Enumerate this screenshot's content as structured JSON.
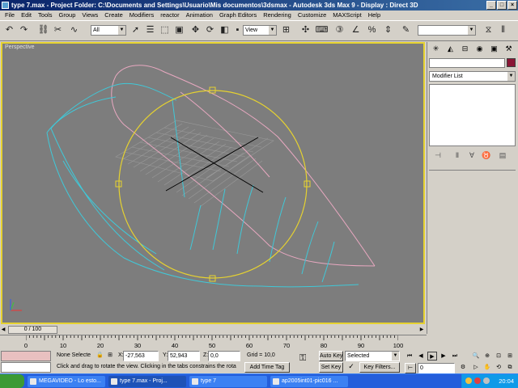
{
  "window": {
    "title": "type 7.max    - Project Folder: C:\\Documents and Settings\\Usuario\\Mis documentos\\3dsmax    - Autodesk 3ds Max 9    - Display : Direct 3D",
    "min": "_",
    "max": "□",
    "close": "×"
  },
  "menu": [
    "File",
    "Edit",
    "Tools",
    "Group",
    "Views",
    "Create",
    "Modifiers",
    "reactor",
    "Animation",
    "Graph Editors",
    "Rendering",
    "Customize",
    "MAXScript",
    "Help"
  ],
  "toolbar": {
    "selection_filter": "All",
    "reference_coord": "View",
    "named_selection": ""
  },
  "viewport": {
    "label": "Perspective",
    "colors": {
      "selection_circle": "#e6d230",
      "hull_cyan": "#40c8d8",
      "hull_pink": "#e8a8c0",
      "grid": "#999999"
    }
  },
  "command_panel": {
    "object_name": "",
    "object_color": "#8a1535",
    "modifier_list": "Modifier List"
  },
  "timeslider": {
    "frame_readout": "0 / 100"
  },
  "trackbar": {
    "ticks": [
      "0",
      "10",
      "20",
      "30",
      "40",
      "50",
      "60",
      "70",
      "80",
      "90",
      "100"
    ]
  },
  "status": {
    "selection": "None Selecte",
    "x_label": "X:",
    "x_value": "-27,563",
    "y_label": "Y:",
    "y_value": "52,943",
    "z_label": "Z:",
    "z_value": "0,0",
    "grid": "Grid = 10,0",
    "prompt": "Click and drag to rotate the view.  Clicking in the tabs constrains the rota",
    "add_time_tag": "Add Time Tag",
    "auto_key": "Auto Key",
    "set_key": "Set Key",
    "key_mode_select": "Selected",
    "key_filters": "Key Filters...",
    "current_frame": "0"
  },
  "taskbar": {
    "items": [
      "MEGAVIDEO - Lo esto...",
      "type 7.max    - Proj...",
      "type 7",
      "ap2005int01-pic016 ..."
    ],
    "clock": "20:04"
  }
}
